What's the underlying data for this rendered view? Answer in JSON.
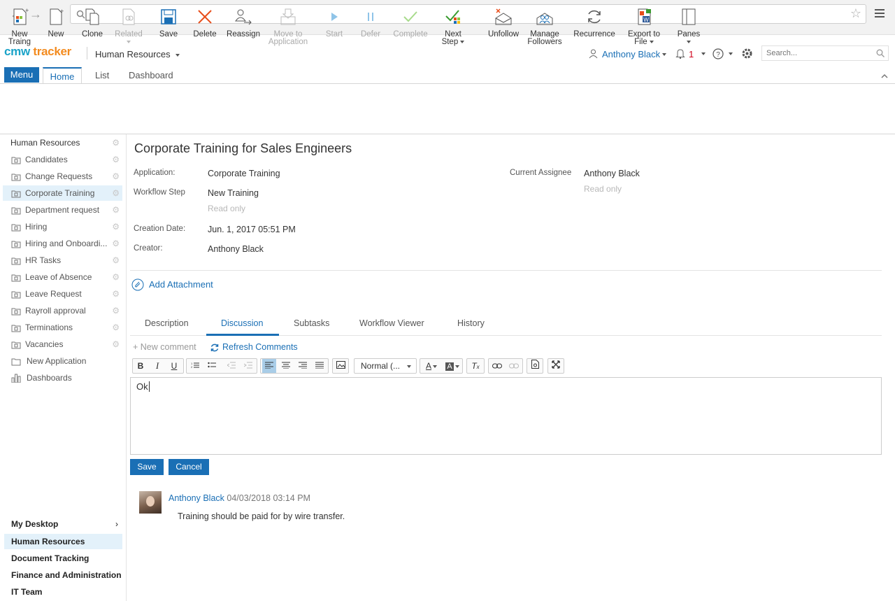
{
  "browser": {
    "url": ""
  },
  "app": {
    "logo_part1": "cmw",
    "logo_part2": "tracker",
    "workspace": "Human Resources",
    "user": "Anthony Black",
    "notifications_count": "1",
    "search_placeholder": "Search..."
  },
  "tabs": {
    "menu": "Menu",
    "home": "Home",
    "list": "List",
    "dashboard": "Dashboard"
  },
  "ribbon": [
    {
      "label1": "New",
      "label2": "Traing",
      "icon": "new-item-icon"
    },
    {
      "label1": "New",
      "label2": "",
      "icon": "new-document-icon"
    },
    {
      "label1": "Clone",
      "label2": "",
      "icon": "clone-icon"
    },
    {
      "label1": "Related",
      "label2": "",
      "icon": "related-icon"
    },
    {
      "label1": "Save",
      "label2": "",
      "icon": "save-icon"
    },
    {
      "label1": "Delete",
      "label2": "",
      "icon": "delete-icon"
    },
    {
      "label1": "Reassign",
      "label2": "",
      "icon": "reassign-icon"
    },
    {
      "label1": "Move to",
      "label2": "Application",
      "icon": "move-icon"
    },
    {
      "label1": "Start",
      "label2": "",
      "icon": "start-icon"
    },
    {
      "label1": "Defer",
      "label2": "",
      "icon": "defer-icon"
    },
    {
      "label1": "Complete",
      "label2": "",
      "icon": "complete-icon"
    },
    {
      "label1": "Next",
      "label2": "Step",
      "icon": "next-step-icon"
    },
    {
      "label1": "Unfollow",
      "label2": "",
      "icon": "unfollow-icon"
    },
    {
      "label1": "Manage",
      "label2": "Followers",
      "icon": "followers-icon"
    },
    {
      "label1": "Recurrence",
      "label2": "",
      "icon": "recurrence-icon"
    },
    {
      "label1": "Export to",
      "label2": "File",
      "icon": "export-icon"
    },
    {
      "label1": "Panes",
      "label2": "",
      "icon": "panes-icon"
    }
  ],
  "sidebar": {
    "header": "Human Resources",
    "items": [
      "Candidates",
      "Change Requests",
      "Corporate Training",
      "Department request",
      "Hiring",
      "Hiring and Onboardi...",
      "HR Tasks",
      "Leave of Absence",
      "Leave Request",
      "Rayroll approval",
      "Terminations",
      "Vacancies"
    ],
    "new_application": "New Application",
    "dashboards": "Dashboards",
    "workspaces": [
      "My Desktop",
      "Human Resources",
      "Document Tracking",
      "Finance and Administration",
      "IT Team"
    ]
  },
  "record": {
    "title": "Corporate Training for Sales Engineers",
    "application_label": "Application:",
    "application_value": "Corporate Training",
    "workflow_label": "Workflow Step",
    "workflow_value": "New Training",
    "read_only": "Read only",
    "creation_label": "Creation Date:",
    "creation_value": "Jun. 1, 2017 05:51 PM",
    "creator_label": "Creator:",
    "creator_value": "Anthony Black",
    "assignee_label": "Current Assignee",
    "assignee_value": "Anthony Black",
    "add_attachment": "Add Attachment"
  },
  "detail_tabs": [
    "Description",
    "Discussion",
    "Subtasks",
    "Workflow Viewer",
    "History"
  ],
  "discussion": {
    "new_comment": "+ New comment",
    "refresh": "Refresh Comments",
    "format_select": "Normal (...",
    "editor_text": "Ok",
    "save": "Save",
    "cancel": "Cancel",
    "comment_author": "Anthony Black",
    "comment_date": "04/03/2018 03:14 PM",
    "comment_text": "Training should be paid for by wire transfer."
  }
}
